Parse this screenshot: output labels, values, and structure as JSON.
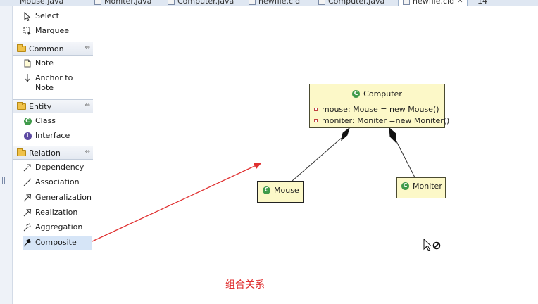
{
  "tabs": [
    {
      "label": "Mouse.java",
      "active": false
    },
    {
      "label": "Moniter.java",
      "active": false
    },
    {
      "label": "Computer.java",
      "active": false
    },
    {
      "label": "newfile.cld",
      "active": false
    },
    {
      "label": "Computer.java",
      "active": false
    },
    {
      "label": "newfile.cld",
      "active": true,
      "close": "✕"
    },
    {
      "label": "14",
      "active": false
    }
  ],
  "palette": {
    "tools": [
      {
        "label": "Select",
        "icon": "arrow-pointer-icon"
      },
      {
        "label": "Marquee",
        "icon": "marquee-icon"
      }
    ],
    "drawers": [
      {
        "label": "Common",
        "items": [
          {
            "label": "Note",
            "icon": "note-icon"
          },
          {
            "label": "Anchor to Note",
            "icon": "anchor-arrow-icon"
          }
        ]
      },
      {
        "label": "Entity",
        "items": [
          {
            "label": "Class",
            "icon": "class-icon"
          },
          {
            "label": "Interface",
            "icon": "interface-icon"
          }
        ]
      },
      {
        "label": "Relation",
        "items": [
          {
            "label": "Dependency",
            "icon": "dependency-icon"
          },
          {
            "label": "Association",
            "icon": "association-icon"
          },
          {
            "label": "Generalization",
            "icon": "generalization-icon"
          },
          {
            "label": "Realization",
            "icon": "realization-icon"
          },
          {
            "label": "Aggregation",
            "icon": "aggregation-icon"
          },
          {
            "label": "Composite",
            "icon": "composite-icon",
            "selected": true
          }
        ]
      }
    ]
  },
  "diagram": {
    "classes": [
      {
        "name": "Computer",
        "attributes": [
          "mouse: Mouse = new Mouse()",
          "moniter: Moniter =new Moniter()"
        ]
      },
      {
        "name": "Mouse",
        "attributes": []
      },
      {
        "name": "Moniter",
        "attributes": []
      }
    ],
    "relations": [
      {
        "type": "composition",
        "whole": "Computer",
        "part": "Mouse"
      },
      {
        "type": "composition",
        "whole": "Computer",
        "part": "Moniter"
      }
    ]
  },
  "annotation": {
    "text": "组合关系",
    "color": "#e03030"
  },
  "colors": {
    "class_fill": "#fcf8c8",
    "class_border": "#4a4a30",
    "selection": "#d6e5f7",
    "annotation_arrow": "#e03030"
  }
}
